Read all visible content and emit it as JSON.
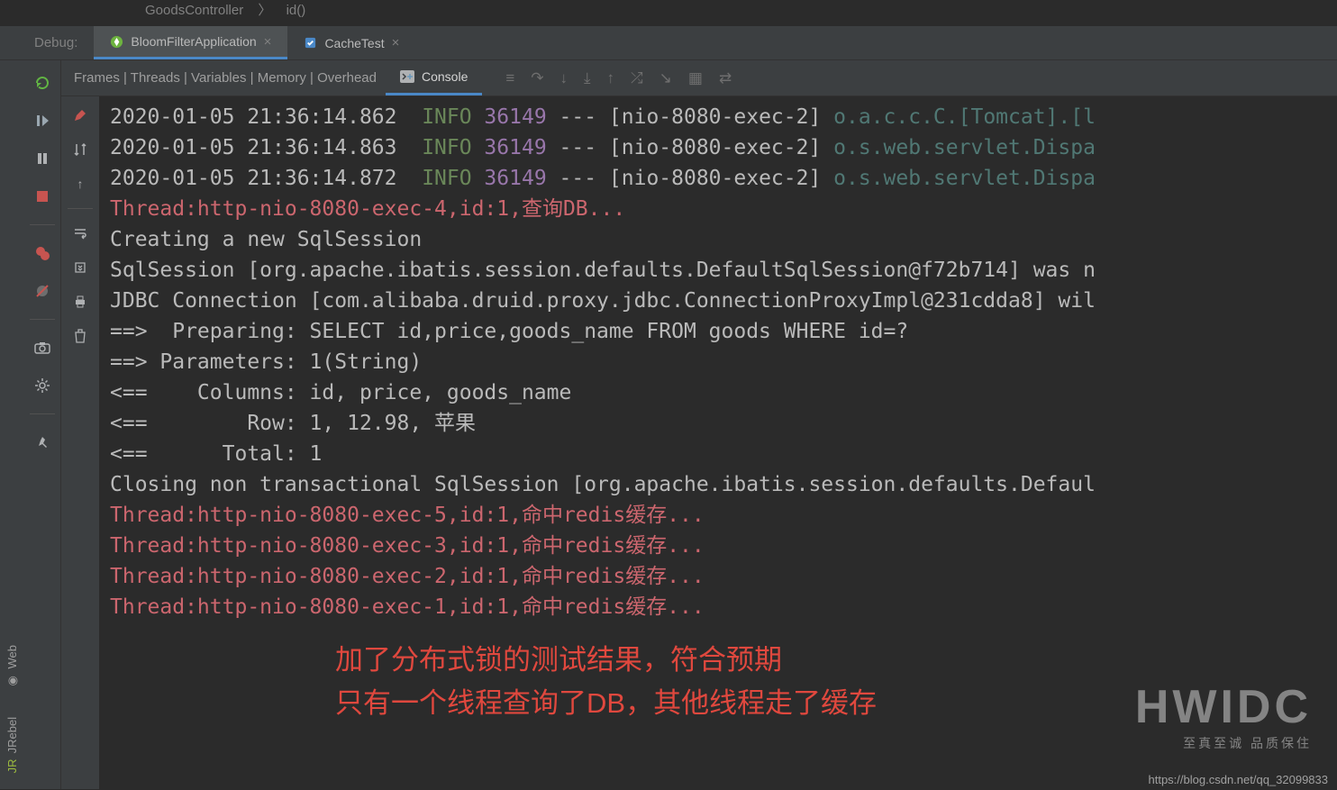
{
  "breadcrumb": {
    "a": "GoodsController",
    "b": "id()"
  },
  "debug": {
    "label": "Debug:",
    "tab1": "BloomFilterApplication",
    "tab2": "CacheTest"
  },
  "views": {
    "list": "Frames | Threads | Variables | Memory | Overhead",
    "console": "Console"
  },
  "left_rail": {
    "web": "Web",
    "jrebel": "JRebel"
  },
  "console_lines": [
    {
      "ts": "2020-01-05 21:36:14.862  ",
      "level": "INFO",
      "pid": " 36149 ",
      "dash": "--- ",
      "thr": "[nio-8080-exec-2] ",
      "logger": "o.a.c.c.C.[Tomcat].[l"
    },
    {
      "ts": "2020-01-05 21:36:14.863  ",
      "level": "INFO",
      "pid": " 36149 ",
      "dash": "--- ",
      "thr": "[nio-8080-exec-2] ",
      "logger": "o.s.web.servlet.Dispa"
    },
    {
      "ts": "2020-01-05 21:36:14.872  ",
      "level": "INFO",
      "pid": " 36149 ",
      "dash": "--- ",
      "thr": "[nio-8080-exec-2] ",
      "logger": "o.s.web.servlet.Dispa"
    }
  ],
  "red_lines_1": [
    "Thread:http-nio-8080-exec-4,id:1,查询DB..."
  ],
  "plain_lines": [
    "Creating a new SqlSession",
    "SqlSession [org.apache.ibatis.session.defaults.DefaultSqlSession@f72b714] was n",
    "JDBC Connection [com.alibaba.druid.proxy.jdbc.ConnectionProxyImpl@231cdda8] wil",
    "==>  Preparing: SELECT id,price,goods_name FROM goods WHERE id=?",
    "==> Parameters: 1(String)",
    "<==    Columns: id, price, goods_name",
    "<==        Row: 1, 12.98, 苹果",
    "<==      Total: 1",
    "Closing non transactional SqlSession [org.apache.ibatis.session.defaults.Defaul"
  ],
  "red_lines_2": [
    "Thread:http-nio-8080-exec-5,id:1,命中redis缓存...",
    "Thread:http-nio-8080-exec-3,id:1,命中redis缓存...",
    "Thread:http-nio-8080-exec-2,id:1,命中redis缓存...",
    "Thread:http-nio-8080-exec-1,id:1,命中redis缓存..."
  ],
  "annotation": {
    "l1": "加了分布式锁的测试结果，符合预期",
    "l2": "只有一个线程查询了DB，其他线程走了缓存"
  },
  "watermark": {
    "big": "HWIDC",
    "small": "至真至诚 品质保住"
  },
  "footer": "https://blog.csdn.net/qq_32099833"
}
